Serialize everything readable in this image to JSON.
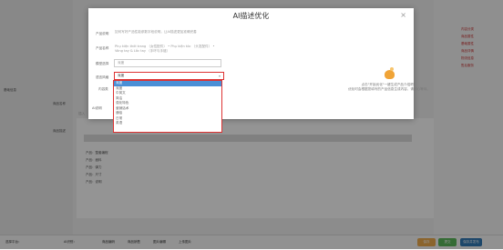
{
  "dialog": {
    "title": "AI描述优化",
    "close": "×",
    "field_help": {
      "label": "产品说明",
      "text": "如何写好产品性能参数字段说明，让AI描述更加准确完善"
    },
    "field_name": {
      "label": "产品名称",
      "text": "Phụ kiện thời trang （女性配件） • Phụ kiện tóc （头发配件） • Vòng tay & Lắc tay （手环与手链）"
    },
    "field_platform": {
      "label": "模型选择",
      "value": "深度"
    },
    "field_lang": {
      "label": "语言风格",
      "value": "深度"
    },
    "dropdown_options": [
      "深度",
      "深度",
      "中英文",
      "简洁",
      "强化特色",
      "营销话术",
      "通俗",
      "日常",
      "英语"
    ],
    "empty_state": {
      "line1": "点击\"开始优化\"一键生成产品介绍吧！",
      "line2": "优化时会根据您填写的产品信息生成内容，请耐心等待。"
    }
  },
  "behind": {
    "label_1": "内容类",
    "label_2": "AI说明",
    "label_3": "插入",
    "section_title": "基础信息",
    "left_labels": [
      "商品名称",
      "商品描述"
    ],
    "editor_lines": [
      "产品：整套编程",
      "产品：面料",
      "产品：弹力",
      "产品：尺寸",
      "产品：说明"
    ],
    "right_items": [
      "内容分类",
      "商品属性",
      "基础属性",
      "商品详情",
      "物流信息",
      "售后服务"
    ],
    "bottom_bar": [
      "选择平台：",
      "AI识别：",
      "商品编码",
      "商品销售",
      "图片编辑",
      "上传图片"
    ],
    "bottom_buttons": [
      "保存",
      "提交",
      "保存并发布"
    ]
  },
  "colors": {
    "accent_red": "#dd3333",
    "selected_blue": "#4a8fd6",
    "btn_yellow": "#f0ad4e",
    "btn_green": "#5cb85c",
    "btn_blue": "#337ab7"
  }
}
